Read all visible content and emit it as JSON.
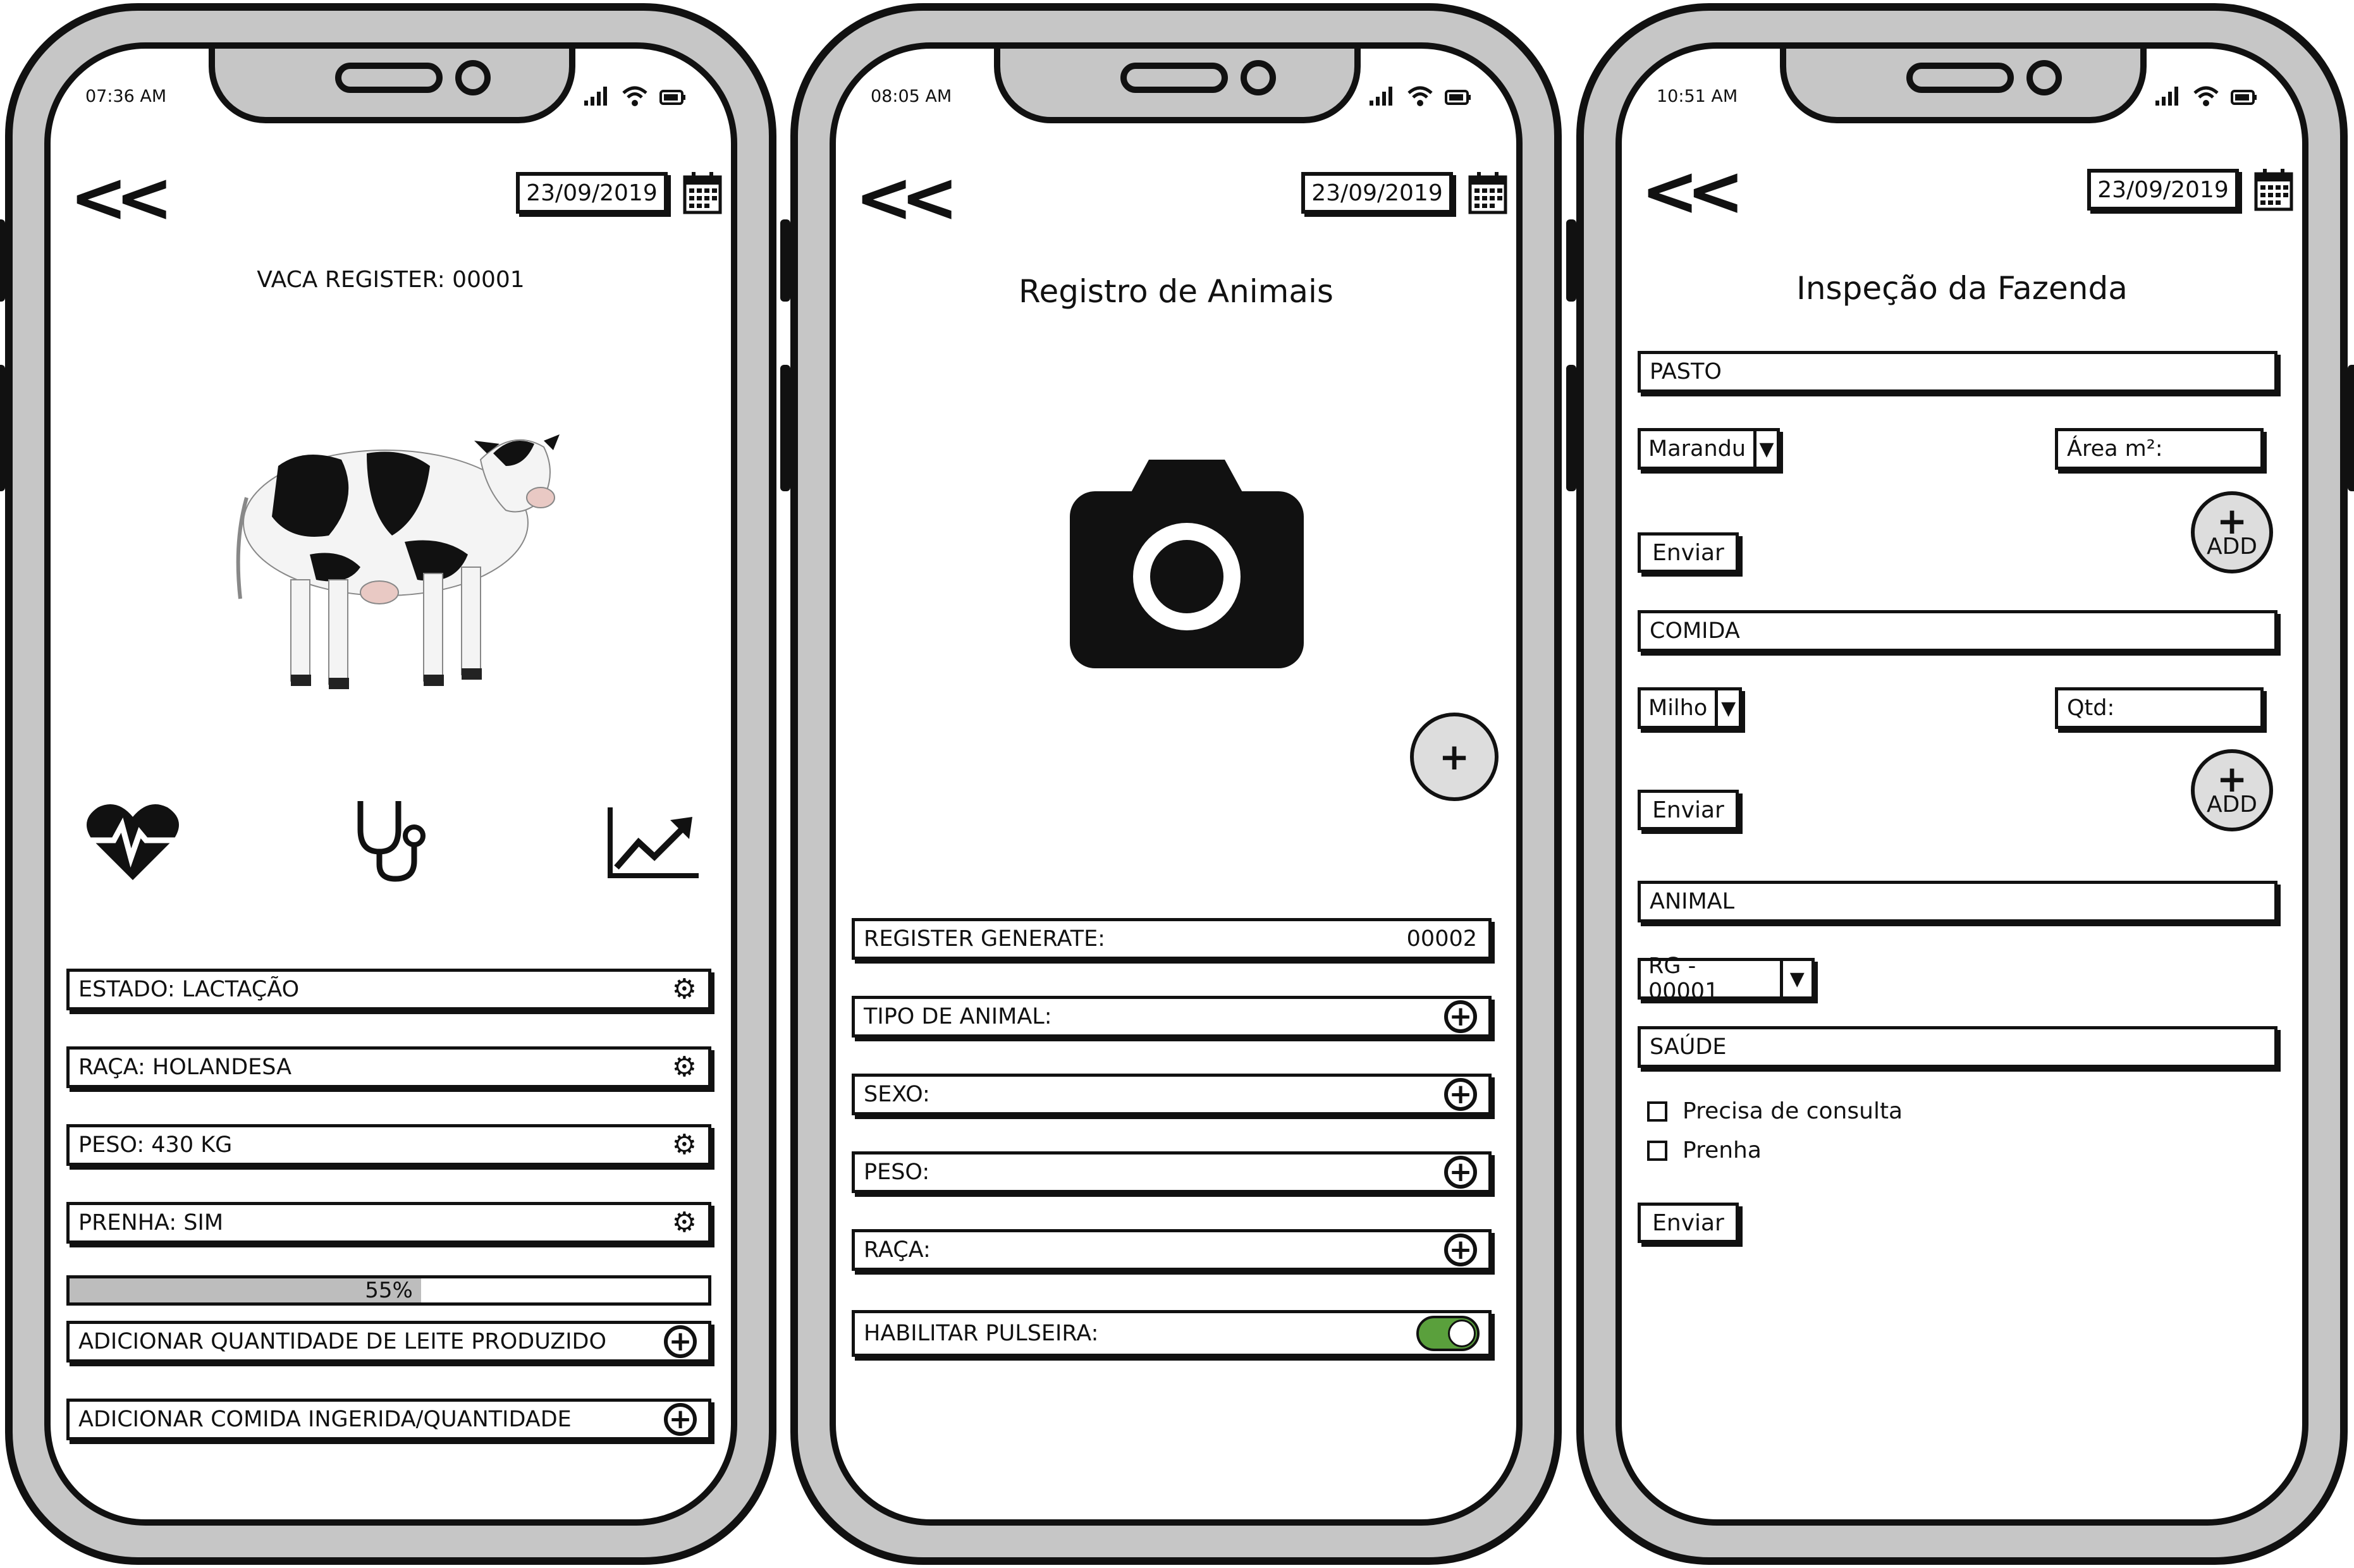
{
  "phone1": {
    "time": "07:36 AM",
    "date": "23/09/2019",
    "register_label": "VACA REGISTER: 00001",
    "fields": [
      {
        "label": "ESTADO: LACTAÇÃO"
      },
      {
        "label": "RAÇA: HOLANDESA"
      },
      {
        "label": "PESO: 430 KG"
      },
      {
        "label": "PRENHA: SIM"
      }
    ],
    "progress": {
      "value": 55,
      "label": "55%"
    },
    "actions": [
      {
        "label": "ADICIONAR QUANTIDADE DE LEITE PRODUZIDO"
      },
      {
        "label": "ADICIONAR COMIDA INGERIDA/QUANTIDADE"
      }
    ]
  },
  "phone2": {
    "time": "08:05 AM",
    "date": "23/09/2019",
    "title": "Registro de Animais",
    "register": {
      "label": "REGISTER GENERATE:",
      "value": "00002"
    },
    "fields": [
      {
        "label": "TIPO DE ANIMAL:"
      },
      {
        "label": "SEXO:"
      },
      {
        "label": "PESO:"
      },
      {
        "label": "RAÇA:"
      }
    ],
    "toggle": {
      "label": "HABILITAR PULSEIRA:",
      "on": true
    }
  },
  "phone3": {
    "time": "10:51 AM",
    "date": "23/09/2019",
    "title": "Inspeção da Fazenda",
    "pasto": {
      "label": "PASTO",
      "select": "Marandu",
      "area_placeholder": "Área m²:",
      "submit": "Enviar",
      "add": "ADD"
    },
    "comida": {
      "label": "COMIDA",
      "select": "Milho",
      "qtd_placeholder": "Qtd:",
      "submit": "Enviar",
      "add": "ADD"
    },
    "animal": {
      "label": "ANIMAL",
      "select": "RG - 00001"
    },
    "saude": {
      "label": "SAÚDE",
      "checks": [
        "Precisa de consulta",
        "Prenha"
      ],
      "submit": "Enviar"
    }
  },
  "colors": {
    "frame": "#c6c6c6",
    "toggle_on": "#5aa03c",
    "progress_fill": "#bdbdbd"
  }
}
